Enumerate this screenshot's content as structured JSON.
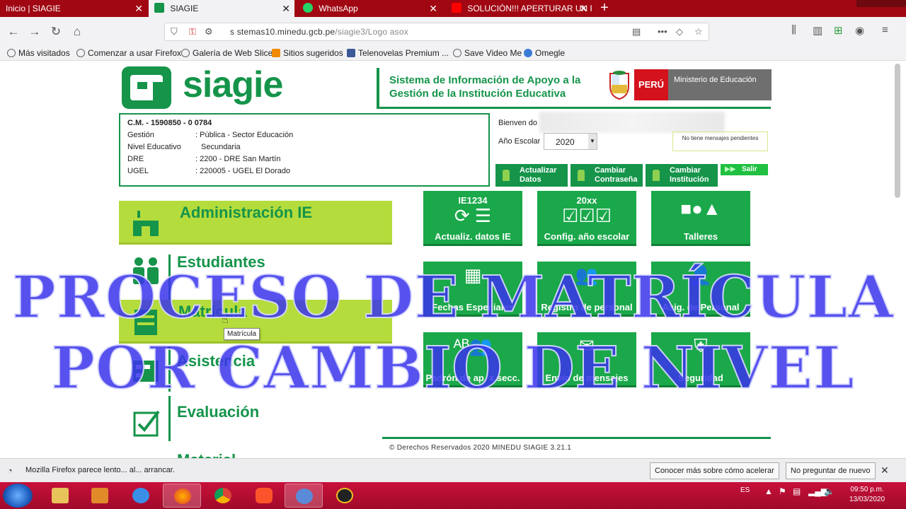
{
  "browser": {
    "tabs": [
      {
        "label": "Inicio | SIAGIE",
        "active": false
      },
      {
        "label": "SIAGIE",
        "active": true
      },
      {
        "label": "WhatsApp",
        "active": false
      },
      {
        "label": "SOLUCIÓN!!! APERTURAR UN F",
        "active": false
      }
    ],
    "url_host": "s stemas10.minedu.gcb.pe",
    "url_path": "/siagie3/Logo asox",
    "bookmarks": [
      "Más visitados",
      "Comenzar a usar Firefox",
      "Galería de Web Slice",
      "Sitios sugeridos",
      "Telenovelas Premium ...",
      "Save Video Me",
      "Omegle"
    ]
  },
  "siagie": {
    "logo_text": "siagie",
    "system_title": "Sistema de Información de Apoyo a la Gestión de la Institución Educativa",
    "peru_label": "PERÚ",
    "ministerio": "Ministerio de Educación",
    "institution": {
      "cm": "C.M. - 1590850 - 0 0784",
      "rows": [
        {
          "label": "Gestión",
          "value": ": Pública - Sector Educación"
        },
        {
          "label": "Nivel Educativo",
          "value": "Secundaria"
        },
        {
          "label": "DRE",
          "value": ": 2200 - DRE San Martín"
        },
        {
          "label": "UGEL",
          "value": ": 220005 - UGEL El Dorado"
        }
      ]
    },
    "bienvenido": "Bienven do",
    "anio_label": "Año Escolar",
    "anio_value": "2020",
    "mensajes": "No tiene mensajes pendientes",
    "actions": [
      "Actualizar Datos",
      "Cambiar Contraseña",
      "Cambiar Institución"
    ],
    "salir": "Salir",
    "menu": [
      "Administración IE",
      "Estudiantes",
      "Matrícula",
      "Asistencia",
      "Evaluación",
      "Material"
    ],
    "tooltip": "Matrícula",
    "tiles": [
      {
        "label": "Actualiz. datos IE",
        "sub": "IE1234"
      },
      {
        "label": "Config. año escolar",
        "sub": "20xx"
      },
      {
        "label": "Talleres",
        "sub": ""
      },
      {
        "label": "Fechas Especiales",
        "sub": ""
      },
      {
        "label": "Registro de personal",
        "sub": ""
      },
      {
        "label": "Asig. de Personal",
        "sub": ""
      },
      {
        "label": "Padrón de ap. x secc.",
        "sub": ""
      },
      {
        "label": "Envío de mensajes",
        "sub": ""
      },
      {
        "label": "Seguridad",
        "sub": ""
      }
    ],
    "footer": "© Derechos Reservados 2020   MINEDU   SIAGIE 3.21.1"
  },
  "overlay": {
    "line1": "PROCESO DE MATRÍCULA",
    "line2": "POR CAMBIO DE NIVEL"
  },
  "notification": {
    "text": "Mozilla Firefox parece lento... al... arrancar.",
    "btn_learn": "Conocer más sobre cómo acelerar",
    "btn_never": "No preguntar de nuevo"
  },
  "taskbar": {
    "lang": "ES",
    "time": "09:50 p.m.",
    "date": "13/03/2020"
  },
  "colors": {
    "siagie_green": "#15944a",
    "tile_green": "#1aa84a",
    "menu_lime": "#b4dc3c",
    "overlay_blue": "#3a34eb",
    "tabbar_red": "#a00712"
  }
}
